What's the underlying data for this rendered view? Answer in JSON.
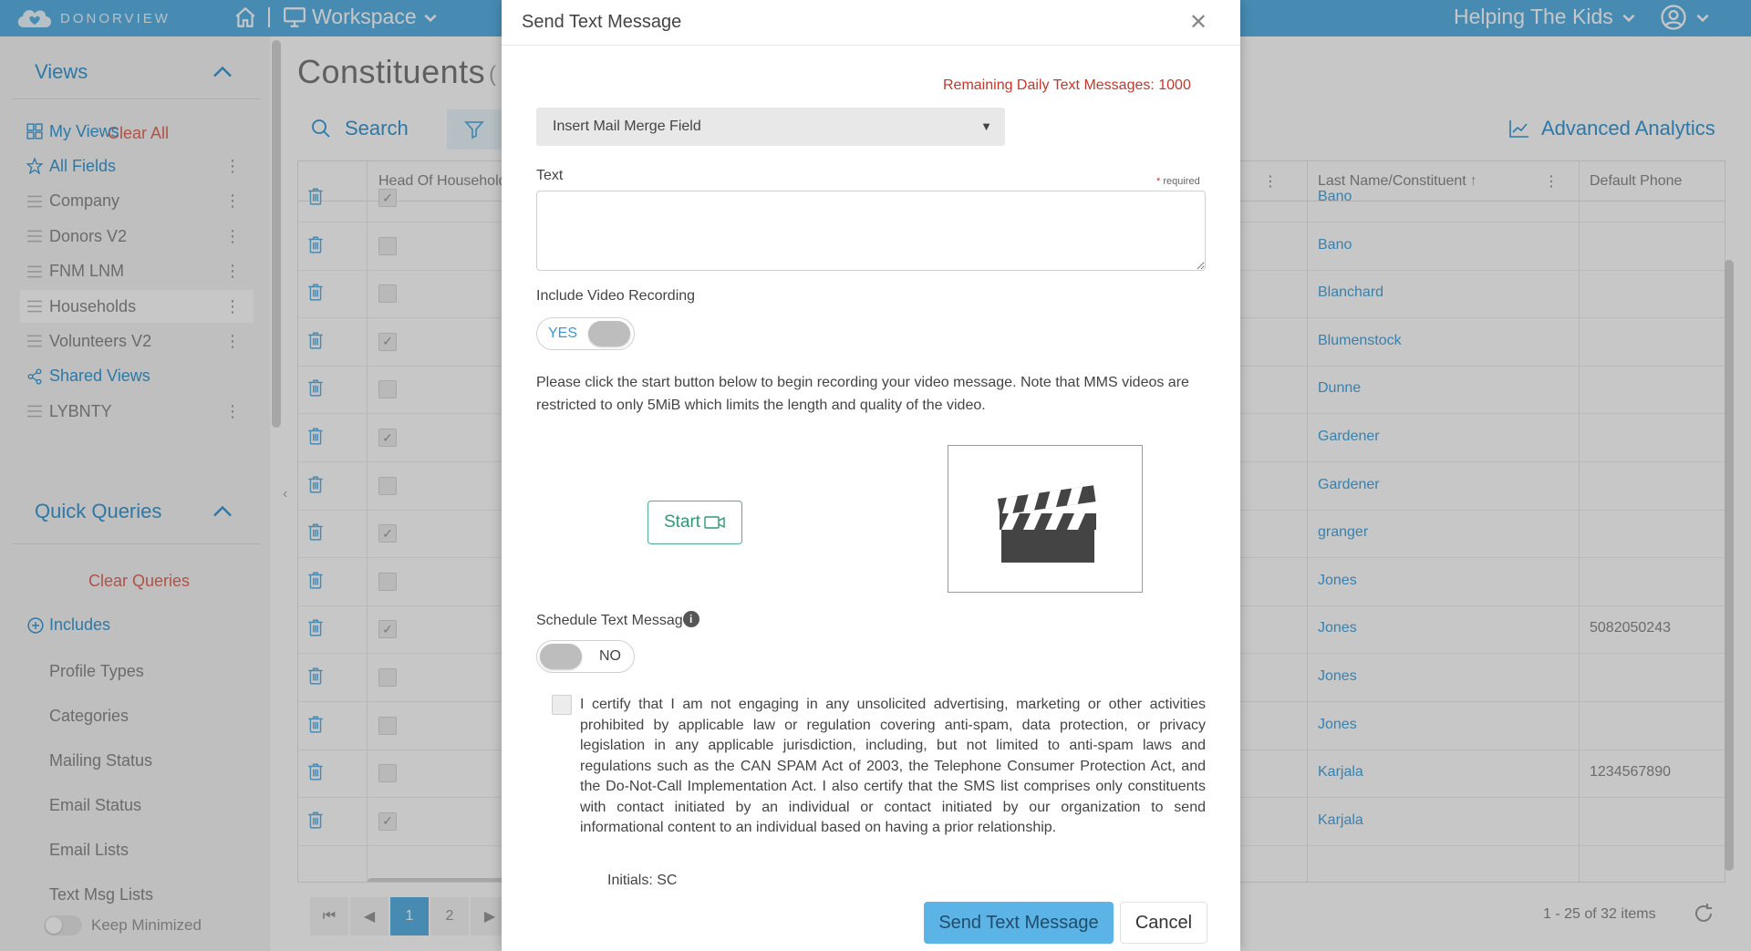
{
  "topbar": {
    "logo_text": "DONORVIEW",
    "workspace_label": "Workspace",
    "org_label": "Helping The Kids"
  },
  "sidebar": {
    "views_title": "Views",
    "clear_all": "Clear All",
    "view_items": [
      {
        "label": "My Views",
        "icon": "grid-icon"
      },
      {
        "label": "All Fields",
        "icon": "star-icon"
      },
      {
        "label": "Company",
        "icon": "menu-icon"
      },
      {
        "label": "Donors V2",
        "icon": "menu-icon"
      },
      {
        "label": "FNM LNM",
        "icon": "menu-icon"
      },
      {
        "label": "Households",
        "icon": "menu-icon"
      },
      {
        "label": "Volunteers V2",
        "icon": "menu-icon"
      },
      {
        "label": "Shared Views",
        "icon": "share-icon"
      },
      {
        "label": "LYBNTY",
        "icon": "menu-icon"
      }
    ],
    "quick_queries_title": "Quick Queries",
    "clear_queries": "Clear Queries",
    "includes_label": "Includes",
    "query_items": [
      "Profile Types",
      "Categories",
      "Mailing Status",
      "Email Status",
      "Email Lists",
      "Text Msg Lists"
    ],
    "keep_minimized": "Keep Minimized"
  },
  "main": {
    "title": "Constituents",
    "title_suffix": "(",
    "search_label": "Search",
    "analytics_label": "Advanced Analytics",
    "columns": {
      "head_of_household": "Head Of Household",
      "last_name": "Last Name/Constituent",
      "default_phone": "Default Phone"
    },
    "rows": [
      {
        "checked": true,
        "last": "Bano",
        "phone": ""
      },
      {
        "checked": false,
        "last": "Bano",
        "phone": ""
      },
      {
        "checked": false,
        "last": "Blanchard",
        "phone": ""
      },
      {
        "checked": true,
        "last": "Blumenstock",
        "phone": ""
      },
      {
        "checked": false,
        "last": "Dunne",
        "phone": ""
      },
      {
        "checked": true,
        "last": "Gardener",
        "phone": ""
      },
      {
        "checked": false,
        "last": "Gardener",
        "phone": ""
      },
      {
        "checked": true,
        "last": "granger",
        "phone": ""
      },
      {
        "checked": false,
        "last": "Jones",
        "phone": ""
      },
      {
        "checked": true,
        "last": "Jones",
        "phone": "5082050243"
      },
      {
        "checked": false,
        "last": "Jones",
        "phone": ""
      },
      {
        "checked": false,
        "last": "Jones",
        "phone": ""
      },
      {
        "checked": false,
        "last": "Karjala",
        "phone": "1234567890"
      },
      {
        "checked": true,
        "last": "Karjala",
        "phone": ""
      }
    ],
    "pager": {
      "page1": "1",
      "page2": "2"
    },
    "items_count": "1 - 25 of 32 items"
  },
  "modal": {
    "title": "Send Text Message",
    "remaining": "Remaining Daily Text Messages: 1000",
    "merge_placeholder": "Insert Mail Merge Field",
    "text_label": "Text",
    "required_star": "*",
    "required_word": "required",
    "text_value": "",
    "video_label": "Include Video Recording",
    "video_toggle": "YES",
    "video_info": "Please click the start button below to begin recording your video message. Note that MMS videos are restricted to only 5MiB which limits the length and quality of the video.",
    "start_label": "Start",
    "schedule_label": "Schedule Text Messag",
    "schedule_toggle": "NO",
    "certify_text": "I certify that I am not engaging in any unsolicited advertising, marketing or other activities prohibited by applicable law or regulation covering anti-spam, data protection, or privacy legislation in any applicable jurisdiction, including, but not limited to anti-spam laws and regulations such as the CAN SPAM Act of 2003, the Telephone Consumer Protection Act, and the Do-Not-Call Implementation Act. I also certify that the SMS list comprises only constituents with contact initiated by an individual or contact initiated by our organization to send informational content to an individual based on having a prior relationship.",
    "initials": "Initials: SC",
    "send_label": "Send Text Message",
    "cancel_label": "Cancel"
  },
  "colors": {
    "brand_blue": "#5cb3e6",
    "link_blue": "#3a9ad6",
    "warning_red": "#c0392b",
    "start_green": "#2e9a73"
  }
}
